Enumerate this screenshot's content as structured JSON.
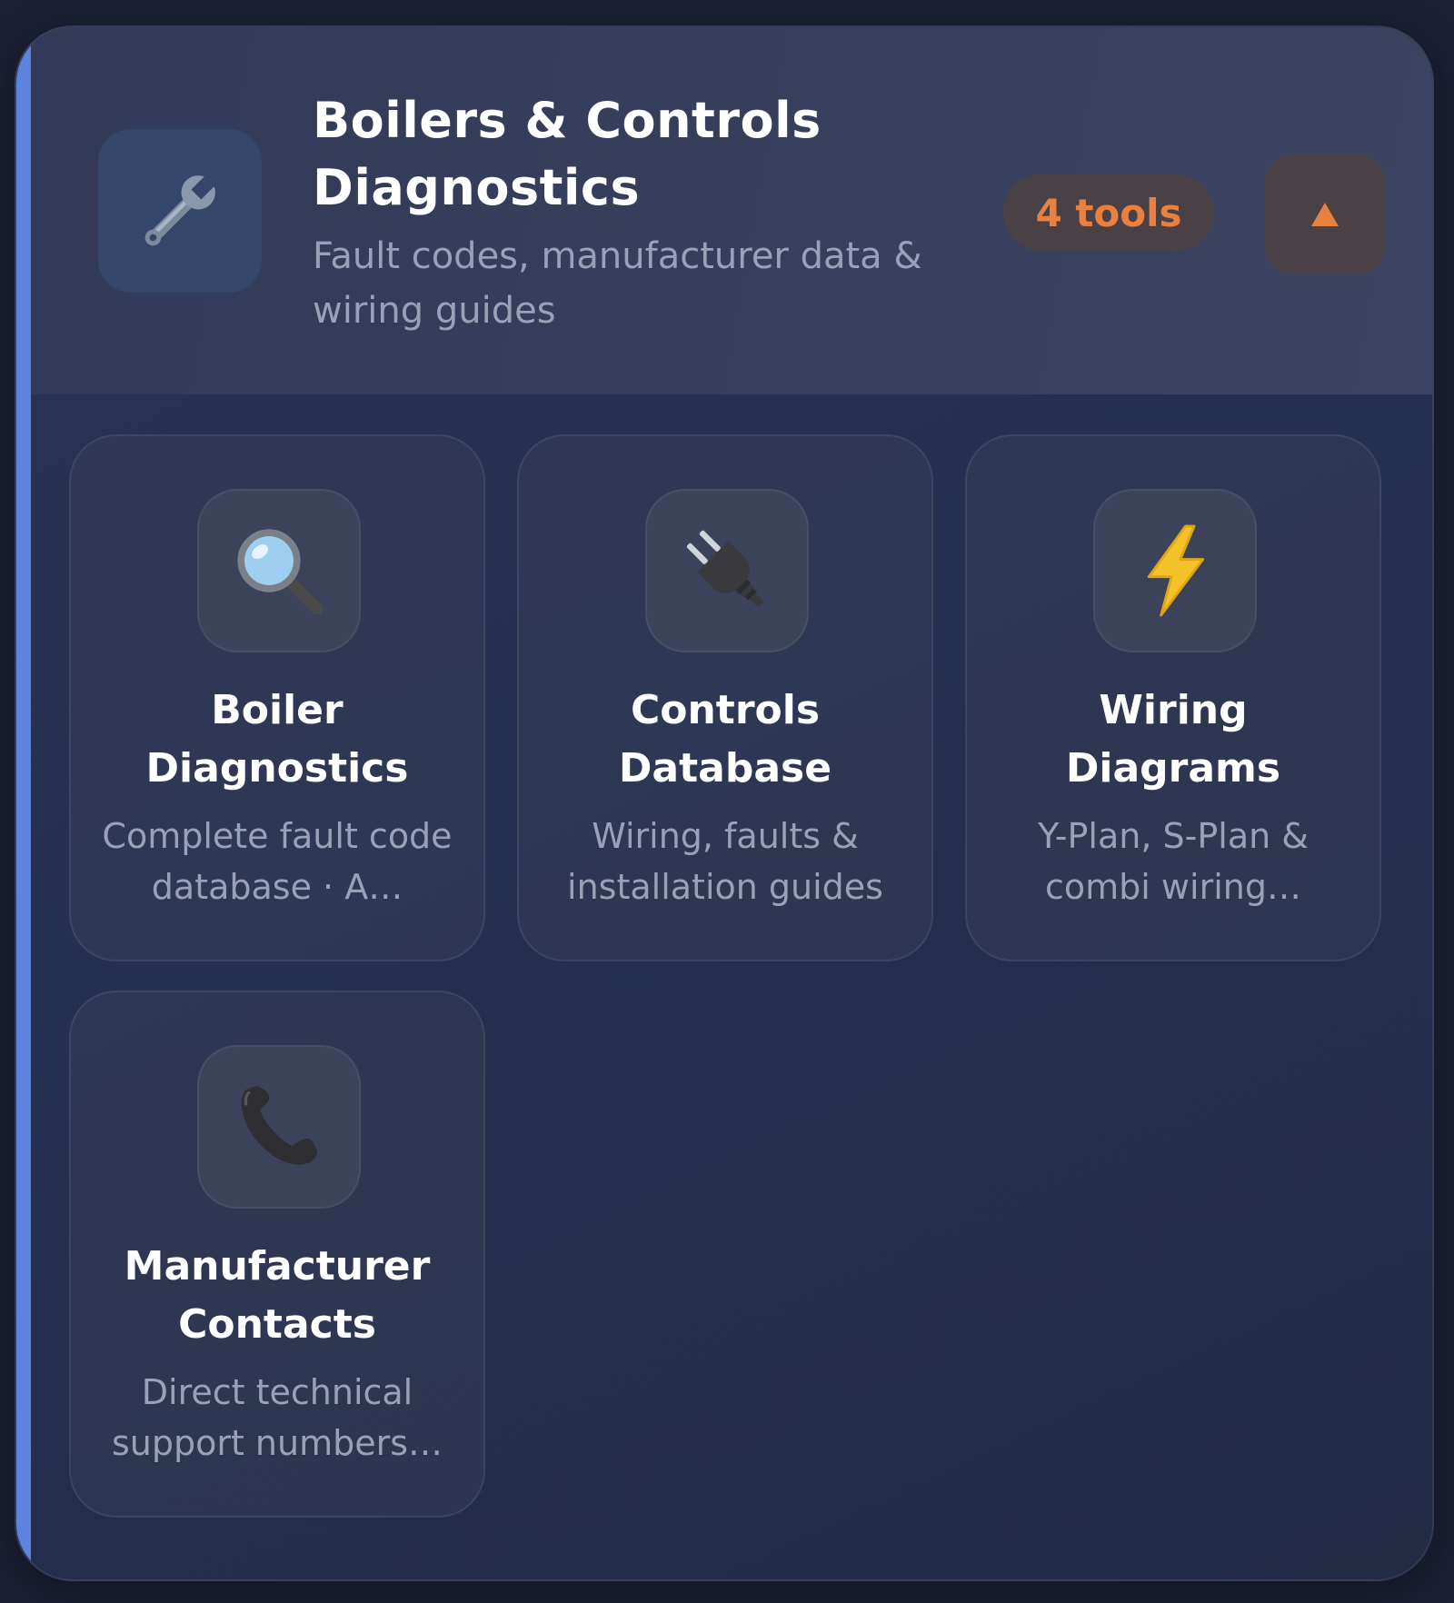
{
  "section": {
    "title": "Boilers & Controls Diagnostics",
    "subtitle": "Fault codes, manufacturer data & wiring guides",
    "icon": "wrench-icon",
    "badge": "4 tools",
    "toggle_icon": "collapse-arrow-up-icon",
    "accent_color": "#5e82e0",
    "badge_color": "#e8803f"
  },
  "tools": [
    {
      "title": "Boiler Diagnostics",
      "description": "Complete fault code database · A…",
      "icon": "magnifying-glass-icon"
    },
    {
      "title": "Controls Database",
      "description": "Wiring, faults & installation guides",
      "icon": "plug-icon"
    },
    {
      "title": "Wiring Diagrams",
      "description": "Y-Plan, S-Plan & combi wiring…",
      "icon": "lightning-bolt-icon"
    },
    {
      "title": "Manufacturer Contacts",
      "description": "Direct technical support numbers…",
      "icon": "telephone-icon"
    }
  ]
}
